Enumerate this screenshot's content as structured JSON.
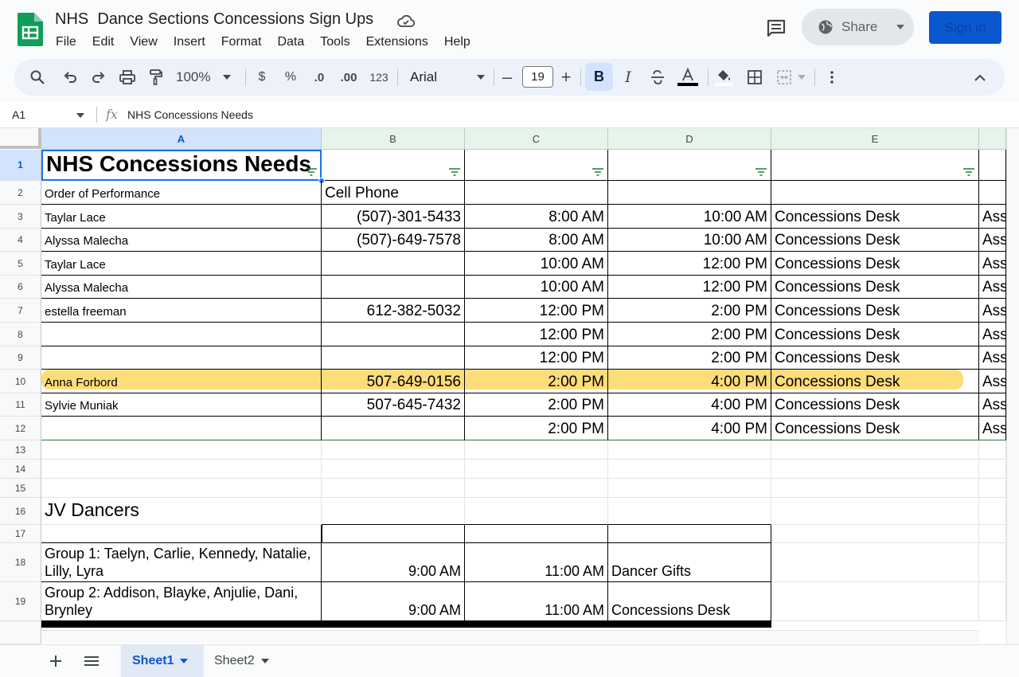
{
  "app": {
    "doc_title": "NHS  Dance Sections Concessions Sign Ups",
    "menu": [
      "File",
      "Edit",
      "View",
      "Insert",
      "Format",
      "Data",
      "Tools",
      "Extensions",
      "Help"
    ],
    "share_label": "Share",
    "signin_label": "Sign in"
  },
  "toolbar": {
    "zoom": "100%",
    "currency": "$",
    "percent": "%",
    "dec_decrease": ".0",
    "dec_increase": ".00",
    "number_format": "123",
    "font": "Arial",
    "font_size": "19",
    "bold": "B",
    "italic": "I"
  },
  "formula": {
    "name_box": "A1",
    "fx": "fx",
    "content": "NHS Concessions Needs"
  },
  "columns": [
    "A",
    "B",
    "C",
    "D",
    "E"
  ],
  "rows": [
    "1",
    "2",
    "3",
    "4",
    "5",
    "6",
    "7",
    "8",
    "9",
    "10",
    "11",
    "12",
    "13",
    "14",
    "15",
    "16",
    "17",
    "18",
    "19"
  ],
  "cells": {
    "a1": "NHS Concessions Needs",
    "a2": "Order of Performance",
    "b2": "Cell Phone",
    "shifts": [
      {
        "name": "Taylar Lace",
        "phone": "(507)-301-5433",
        "start": "8:00 AM",
        "end": "10:00 AM",
        "location": "Concessions Desk",
        "f": "Ass"
      },
      {
        "name": "Alyssa Malecha",
        "phone": "(507)-649-7578",
        "start": "8:00 AM",
        "end": "10:00 AM",
        "location": "Concessions Desk",
        "f": "Ass"
      },
      {
        "name": "Taylar Lace",
        "phone": "",
        "start": "10:00 AM",
        "end": "12:00 PM",
        "location": "Concessions Desk",
        "f": "Ass"
      },
      {
        "name": "Alyssa Malecha",
        "phone": "",
        "start": "10:00 AM",
        "end": "12:00 PM",
        "location": "Concessions Desk",
        "f": "Ass"
      },
      {
        "name": "estella freeman",
        "phone": "612-382-5032",
        "start": "12:00 PM",
        "end": "2:00 PM",
        "location": "Concessions Desk",
        "f": "Ass"
      },
      {
        "name": "",
        "phone": "",
        "start": "12:00 PM",
        "end": "2:00 PM",
        "location": "Concessions Desk",
        "f": "Ass"
      },
      {
        "name": "",
        "phone": "",
        "start": "12:00 PM",
        "end": "2:00 PM",
        "location": "Concessions Desk",
        "f": "Ass"
      },
      {
        "name": "Anna Forbord",
        "phone": "507-649-0156",
        "start": "2:00 PM",
        "end": "4:00 PM",
        "location": "Concessions Desk",
        "f": "Ass"
      },
      {
        "name": "Sylvie Muniak",
        "phone": "507-645-7432",
        "start": "2:00 PM",
        "end": "4:00 PM",
        "location": "Concessions Desk",
        "f": "Ass"
      },
      {
        "name": "",
        "phone": "",
        "start": "2:00 PM",
        "end": "4:00 PM",
        "location": "Concessions Desk",
        "f": "Ass"
      }
    ],
    "a16": "JV Dancers",
    "groups": [
      {
        "name": "Group 1: Taelyn, Carlie, Kennedy, Natalie, Lilly, Lyra",
        "start": "9:00 AM",
        "end": "11:00 AM",
        "location": "Dancer Gifts"
      },
      {
        "name": "Group 2: Addison, Blayke, Anjulie, Dani, Brynley",
        "start": "9:00 AM",
        "end": "11:00 AM",
        "location": "Concessions Desk"
      }
    ]
  },
  "sheets": [
    "Sheet1",
    "Sheet2"
  ],
  "colors": {
    "accent": "#0b57d0",
    "highlight": "#fdd663",
    "sheets_green": "#0f9d58"
  }
}
